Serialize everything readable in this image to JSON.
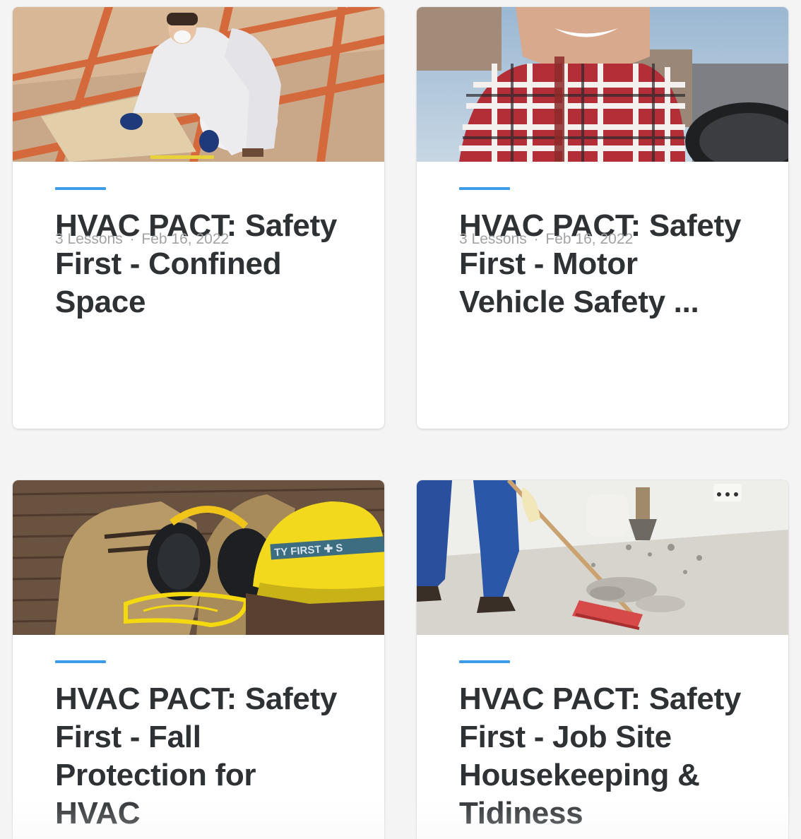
{
  "courses": [
    {
      "title": "HVAC PACT: Safety First - Confined Space",
      "lessons": "3 Lessons",
      "separator": "·",
      "date": "Feb 16, 2022",
      "image_icon": "worker-insulation-image"
    },
    {
      "title": "HVAC PACT: Safety First - Motor Vehicle Safety ...",
      "lessons": "3 Lessons",
      "separator": "·",
      "date": "Feb 16, 2022",
      "image_icon": "driver-smiling-image"
    },
    {
      "title": "HVAC PACT: Safety First - Fall Protection for HVAC Professionals",
      "image_icon": "safety-gear-image",
      "helmet_text": "TY FIRST ✚ S"
    },
    {
      "title": "HVAC PACT: Safety First - Job Site Housekeeping & Tidiness",
      "image_icon": "sweeping-debris-image"
    }
  ],
  "colors": {
    "accent": "#3d9be9",
    "title": "#2f3235",
    "meta": "#a3a3a3",
    "background": "#f4f4f4"
  }
}
